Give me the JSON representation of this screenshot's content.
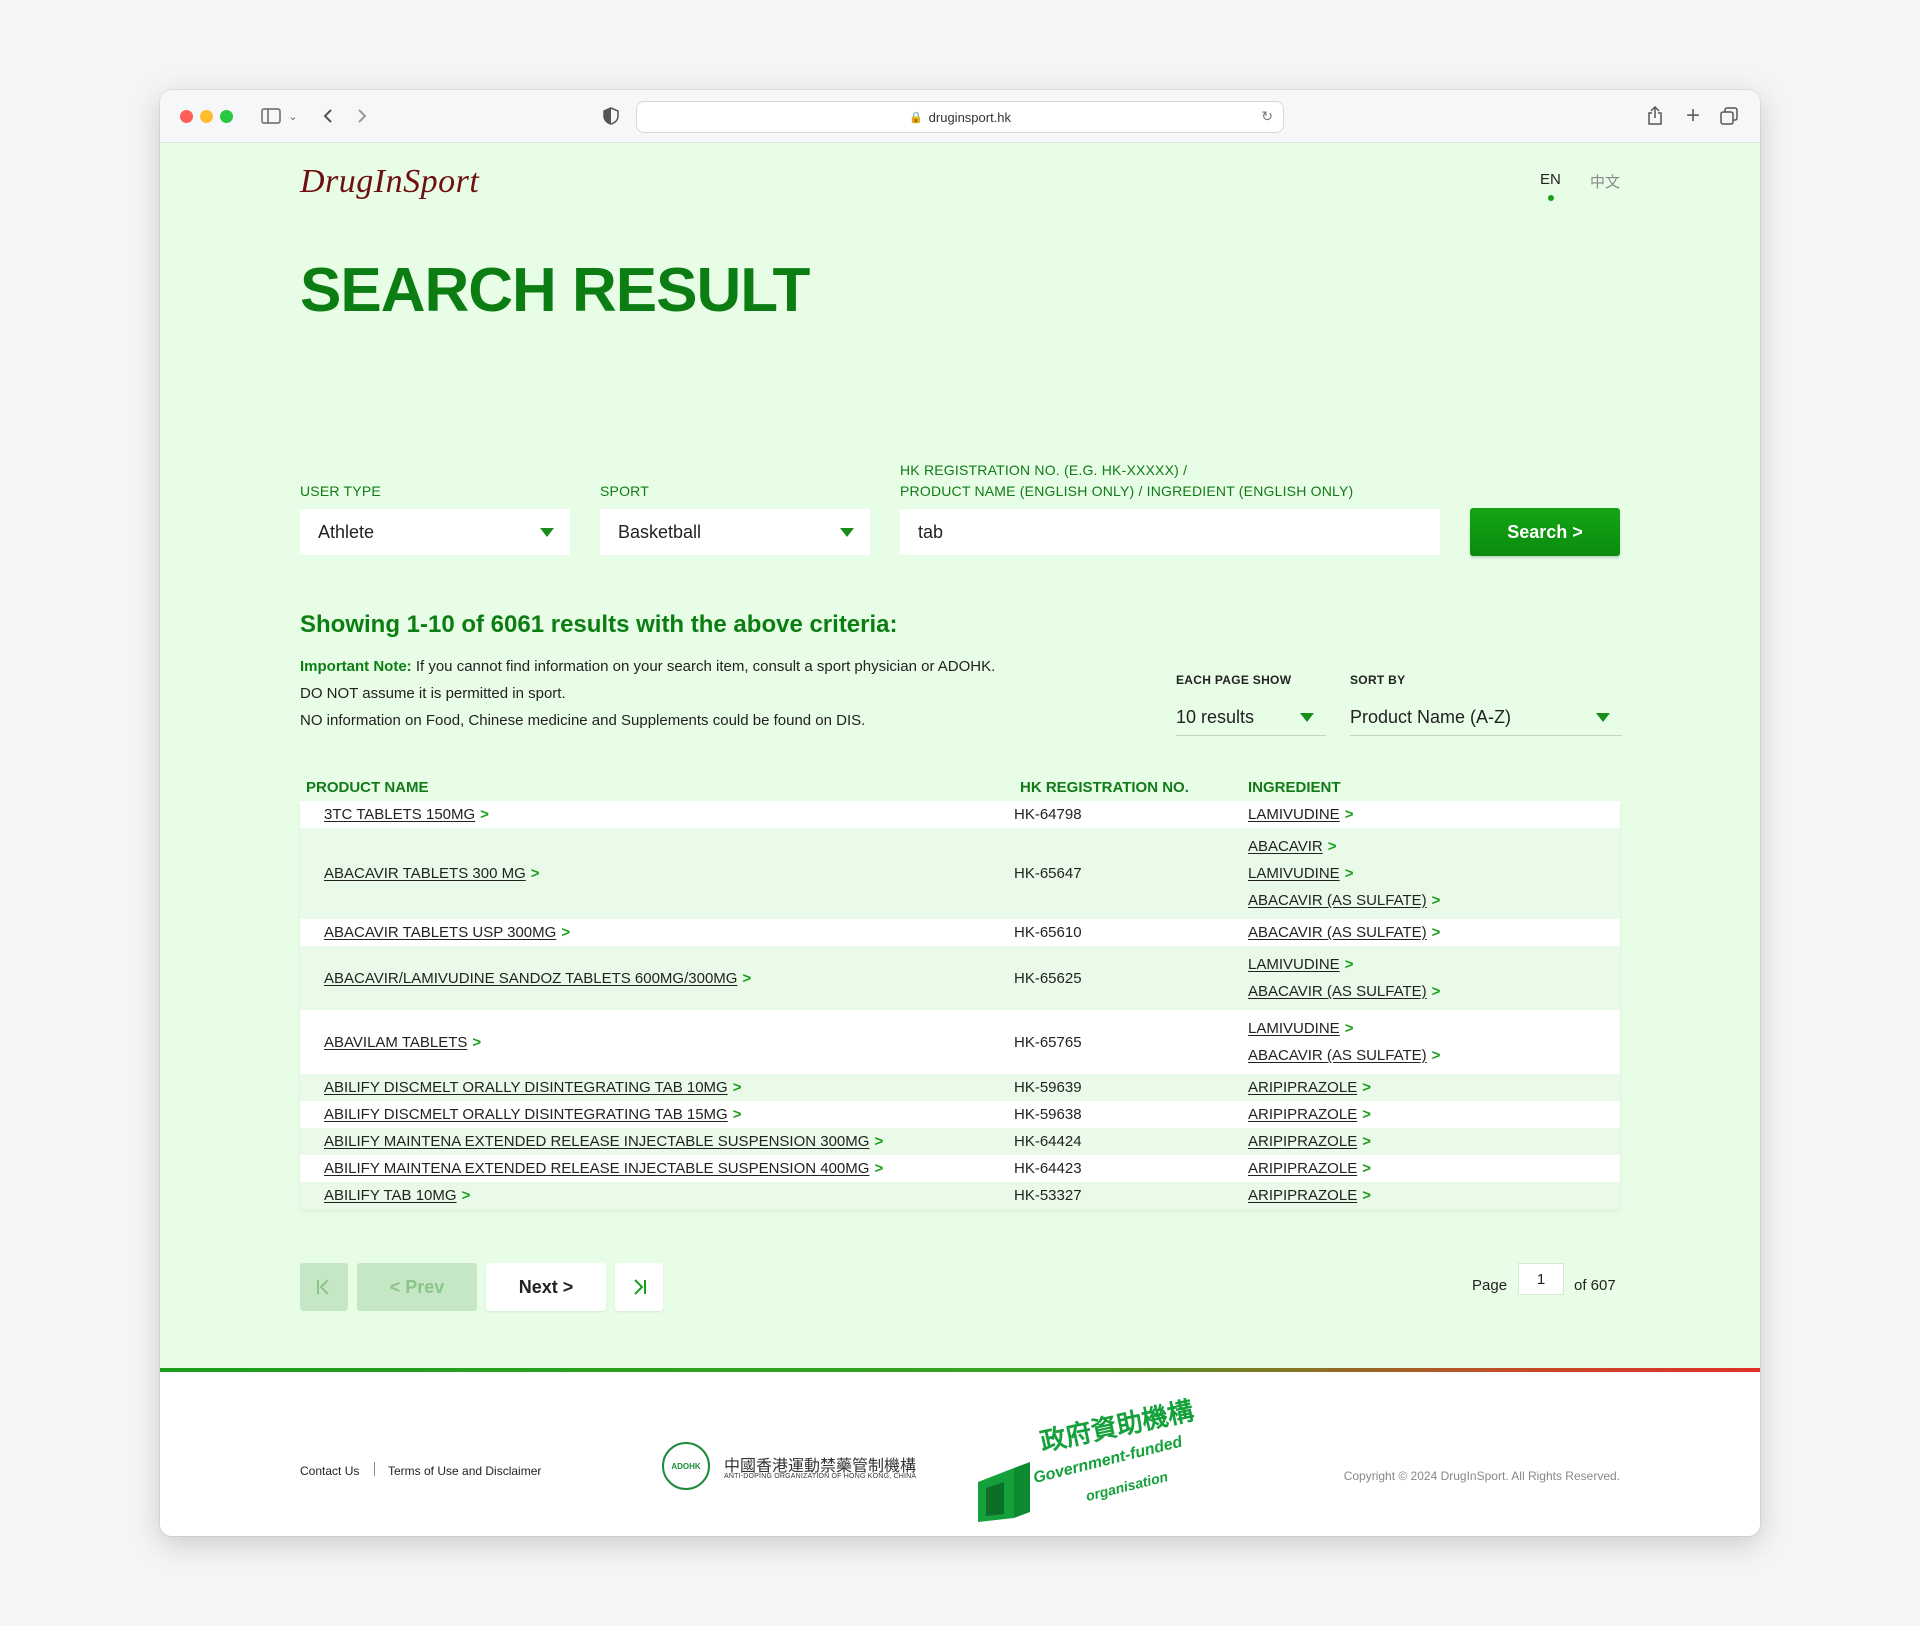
{
  "browser": {
    "url": "druginsport.hk"
  },
  "header": {
    "logo": "DrugInSport",
    "lang_en": "EN",
    "lang_zh": "中文"
  },
  "title": "SEARCH RESULT",
  "filters": {
    "user_type_label": "USER TYPE",
    "user_type_value": "Athlete",
    "sport_label": "SPORT",
    "sport_value": "Basketball",
    "query_label_line1": "HK REGISTRATION NO. (E.G. HK-XXXXX) /",
    "query_label_line2": "PRODUCT NAME (ENGLISH ONLY) / INGREDIENT (ENGLISH ONLY)",
    "query_value": "tab",
    "search_button": "Search >"
  },
  "results": {
    "summary": "Showing 1-10 of 6061 results with the above criteria:",
    "note_bold": "Important Note:",
    "note_text": " If you cannot find information on your search item, consult a sport physician or ADOHK.",
    "note_line2": "DO NOT assume it is permitted in sport.",
    "note_line3": "NO information on Food, Chinese medicine and Supplements could be found on DIS.",
    "page_size_label": "EACH PAGE SHOW",
    "page_size_value": "10 results",
    "sort_label": "SORT BY",
    "sort_value": "Product Name (A-Z)"
  },
  "table": {
    "headers": {
      "product": "PRODUCT NAME",
      "reg": "HK REGISTRATION NO.",
      "ingredient": "INGREDIENT"
    },
    "rows": [
      {
        "product": "3TC TABLETS 150MG",
        "reg": "HK-64798",
        "ingredients": [
          "LAMIVUDINE"
        ]
      },
      {
        "product": "ABACAVIR TABLETS 300 MG",
        "reg": "HK-65647",
        "ingredients": [
          "ABACAVIR",
          "LAMIVUDINE",
          "ABACAVIR (AS SULFATE)"
        ]
      },
      {
        "product": "ABACAVIR TABLETS USP 300MG",
        "reg": "HK-65610",
        "ingredients": [
          "ABACAVIR (AS SULFATE)"
        ]
      },
      {
        "product": "ABACAVIR/LAMIVUDINE SANDOZ TABLETS 600MG/300MG",
        "reg": "HK-65625",
        "ingredients": [
          "LAMIVUDINE",
          "ABACAVIR (AS SULFATE)"
        ]
      },
      {
        "product": "ABAVILAM TABLETS",
        "reg": "HK-65765",
        "ingredients": [
          "LAMIVUDINE",
          "ABACAVIR (AS SULFATE)"
        ]
      },
      {
        "product": "ABILIFY DISCMELT ORALLY DISINTEGRATING TAB 10MG",
        "reg": "HK-59639",
        "ingredients": [
          "ARIPIPRAZOLE"
        ]
      },
      {
        "product": "ABILIFY DISCMELT ORALLY DISINTEGRATING TAB 15MG",
        "reg": "HK-59638",
        "ingredients": [
          "ARIPIPRAZOLE"
        ]
      },
      {
        "product": "ABILIFY MAINTENA EXTENDED RELEASE INJECTABLE SUSPENSION 300MG",
        "reg": "HK-64424",
        "ingredients": [
          "ARIPIPRAZOLE"
        ]
      },
      {
        "product": "ABILIFY MAINTENA EXTENDED RELEASE INJECTABLE SUSPENSION 400MG",
        "reg": "HK-64423",
        "ingredients": [
          "ARIPIPRAZOLE"
        ]
      },
      {
        "product": "ABILIFY TAB 10MG",
        "reg": "HK-53327",
        "ingredients": [
          "ARIPIPRAZOLE"
        ]
      }
    ]
  },
  "pagination": {
    "first_icon": "|<",
    "prev": "< Prev",
    "next": "Next >",
    "last_icon": ">|",
    "page_label": "Page",
    "current_page": "1",
    "of_label": "of 607"
  },
  "footer": {
    "contact": "Contact Us",
    "terms": "Terms of Use and Disclaimer",
    "adohk_seal": "ADOHK",
    "adohk_zh": "中國香港運動禁藥管制機構",
    "adohk_en": "ANTI-DOPING ORGANIZATION OF HONG KONG, CHINA",
    "gov_zh": "政府資助機構",
    "gov_en1": "Government-funded",
    "gov_en2": "organisation",
    "copyright": "Copyright © 2024 DrugInSport. All Rights Reserved."
  },
  "colors": {
    "accent_green": "#0c7d12",
    "page_bg": "#e7fde6",
    "logo_maroon": "#6e0f10"
  }
}
